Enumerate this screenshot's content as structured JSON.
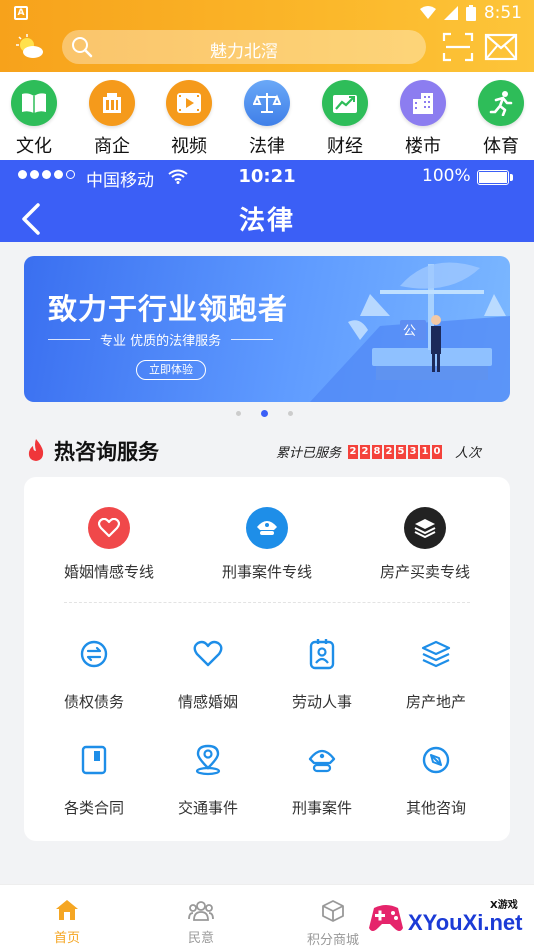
{
  "status_bar": {
    "time": "8:51"
  },
  "header": {
    "search_placeholder": "魅力北滘"
  },
  "categories": [
    {
      "label": "文化",
      "icon": "book-icon",
      "color": "#2ebd59"
    },
    {
      "label": "商企",
      "icon": "building-icon",
      "color": "#f59a1b"
    },
    {
      "label": "视频",
      "icon": "film-icon",
      "color": "#f59a1b"
    },
    {
      "label": "法律",
      "icon": "scale-icon",
      "color": "#4a8bf0",
      "active": true
    },
    {
      "label": "财经",
      "icon": "chart-icon",
      "color": "#2ebd59"
    },
    {
      "label": "楼市",
      "icon": "building-icon",
      "color": "#8c7df0"
    },
    {
      "label": "体育",
      "icon": "runner-icon",
      "color": "#2ebd59"
    }
  ],
  "inner_status": {
    "carrier": "中国移动",
    "time": "10:21",
    "battery": "100%"
  },
  "navbar": {
    "title": "法律"
  },
  "banner": {
    "headline": "致力于行业领跑者",
    "subline": "专业 优质的法律服务",
    "cta": "立即体验",
    "sign": "公"
  },
  "section": {
    "title": "热咨询服务",
    "stat_prefix": "累计已服务",
    "stat_digits": [
      "2",
      "2",
      "8",
      "2",
      "5",
      "3",
      "1",
      "0"
    ],
    "stat_suffix": "人次"
  },
  "featured_services": [
    {
      "label": "婚姻情感专线",
      "icon": "heart-icon",
      "color": "#f0484a"
    },
    {
      "label": "刑事案件专线",
      "icon": "police-cap-icon",
      "color": "#1e8ee8"
    },
    {
      "label": "房产买卖专线",
      "icon": "layers-icon",
      "color": "#222222"
    }
  ],
  "services": [
    {
      "label": "债权债务",
      "icon": "exchange-icon"
    },
    {
      "label": "情感婚姻",
      "icon": "heart-outline-icon"
    },
    {
      "label": "劳动人事",
      "icon": "badge-icon"
    },
    {
      "label": "房产地产",
      "icon": "layers-outline-icon"
    },
    {
      "label": "各类合同",
      "icon": "contract-icon"
    },
    {
      "label": "交通事件",
      "icon": "location-icon"
    },
    {
      "label": "刑事案件",
      "icon": "police-cap-outline-icon"
    },
    {
      "label": "其他咨询",
      "icon": "compass-icon"
    }
  ],
  "tabbar": [
    {
      "label": "首页",
      "icon": "home-icon",
      "active": true
    },
    {
      "label": "民意",
      "icon": "people-icon"
    },
    {
      "label": "积分商城",
      "icon": "box-icon"
    }
  ],
  "watermark": {
    "top": "X游戏",
    "main": "XYouXi.net"
  },
  "colors": {
    "accent": "#f5a623",
    "primary_blue": "#3b5ff6",
    "service_blue": "#1e8ee8"
  }
}
